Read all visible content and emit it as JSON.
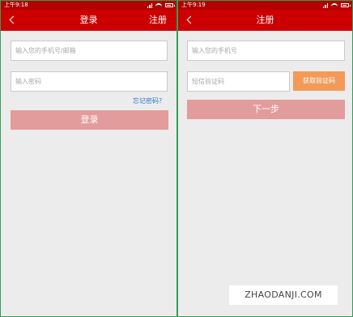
{
  "left": {
    "status_time": "上午9:18",
    "title": "登录",
    "right_action": "注册",
    "account_placeholder": "输入您的手机号/邮箱",
    "password_placeholder": "输入密码",
    "forgot_link": "忘记密码?",
    "login_button": "登录"
  },
  "right": {
    "status_time": "上午9:19",
    "title": "注册",
    "phone_placeholder": "输入您的手机号",
    "sms_placeholder": "短信验证码",
    "sms_button": "获取验证码",
    "next_button": "下一步"
  },
  "watermark": "ZHAODANJI.COM",
  "colors": {
    "nav": "#cc0000",
    "status": "#b40000",
    "primary_disabled": "#e39c9c",
    "sms_button": "#f39a59",
    "link": "#2a7ac0"
  }
}
